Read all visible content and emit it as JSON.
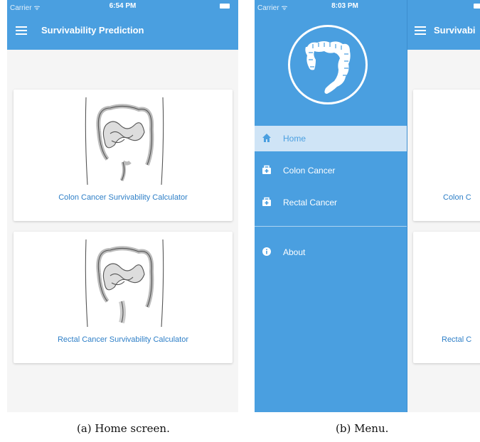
{
  "screen_a": {
    "status": {
      "carrier": "Carrier ᯤ",
      "time": "6:54 PM"
    },
    "nav": {
      "title": "Survivability Prediction",
      "menu_icon": "hamburger-icon"
    },
    "cards": [
      {
        "label": "Colon Cancer Survivability Calculator",
        "image_icon": "colon-anatomy-illustration"
      },
      {
        "label": "Rectal Cancer Survivability Calculator",
        "image_icon": "rectum-anatomy-illustration"
      }
    ],
    "caption": "(a) Home screen."
  },
  "screen_b": {
    "status": {
      "carrier": "Carrier ᯤ",
      "time": "8:03 PM"
    },
    "logo_icon": "colon-logo-icon",
    "menu": [
      {
        "label": "Home",
        "icon": "home-icon",
        "active": true
      },
      {
        "label": "Colon Cancer",
        "icon": "medkit-icon",
        "active": false
      },
      {
        "label": "Rectal Cancer",
        "icon": "medkit-icon",
        "active": false
      },
      {
        "label": "About",
        "icon": "info-icon",
        "active": false
      }
    ],
    "behind": {
      "nav_title_partial": "Survivabi",
      "card1_partial": "Colon C",
      "card2_partial": "Rectal C"
    },
    "caption": "(b) Menu."
  },
  "colors": {
    "primary": "#4a9fe0",
    "link": "#2e7fc7",
    "background": "#f5f5f5",
    "active_item": "#cfe4f6"
  }
}
